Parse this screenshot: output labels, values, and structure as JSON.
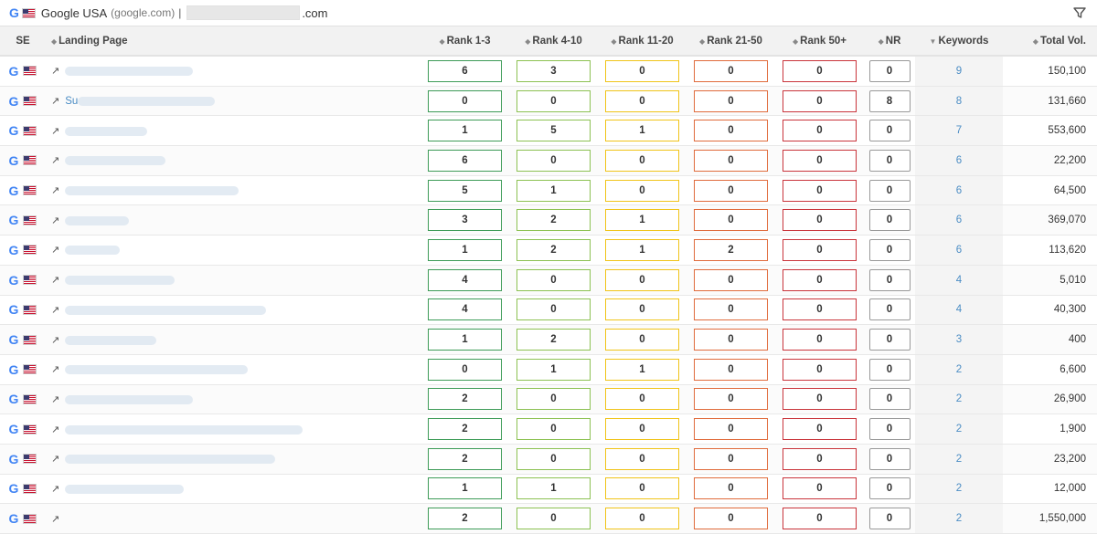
{
  "topbar": {
    "se_name": "Google USA",
    "se_domain": "(google.com)",
    "separator": "|",
    "domain_suffix": ".com"
  },
  "colors": {
    "rank_1_3": "#3d9b57",
    "rank_4_10": "#8cc152",
    "rank_11_20": "#f0c419",
    "rank_21_50": "#e06b3c",
    "rank_50_plus": "#c9343b",
    "nr": "#999999",
    "link": "#4a8cc4"
  },
  "header": {
    "se": "SE",
    "landing_page": "Landing Page",
    "rank_1_3": "Rank 1-3",
    "rank_4_10": "Rank 4-10",
    "rank_11_20": "Rank 11-20",
    "rank_21_50": "Rank 21-50",
    "rank_50_plus": "Rank 50+",
    "nr": "NR",
    "keywords": "Keywords",
    "total_vol": "Total Vol."
  },
  "rows": [
    {
      "lp": "",
      "r1": "6",
      "r2": "3",
      "r3": "0",
      "r4": "0",
      "r5": "0",
      "nr": "0",
      "kw": "9",
      "vol": "150,100"
    },
    {
      "lp": "Su",
      "r1": "0",
      "r2": "0",
      "r3": "0",
      "r4": "0",
      "r5": "0",
      "nr": "8",
      "kw": "8",
      "vol": "131,660"
    },
    {
      "lp": "",
      "r1": "1",
      "r2": "5",
      "r3": "1",
      "r4": "0",
      "r5": "0",
      "nr": "0",
      "kw": "7",
      "vol": "553,600"
    },
    {
      "lp": "",
      "r1": "6",
      "r2": "0",
      "r3": "0",
      "r4": "0",
      "r5": "0",
      "nr": "0",
      "kw": "6",
      "vol": "22,200"
    },
    {
      "lp": "",
      "r1": "5",
      "r2": "1",
      "r3": "0",
      "r4": "0",
      "r5": "0",
      "nr": "0",
      "kw": "6",
      "vol": "64,500"
    },
    {
      "lp": "",
      "r1": "3",
      "r2": "2",
      "r3": "1",
      "r4": "0",
      "r5": "0",
      "nr": "0",
      "kw": "6",
      "vol": "369,070"
    },
    {
      "lp": "",
      "r1": "1",
      "r2": "2",
      "r3": "1",
      "r4": "2",
      "r5": "0",
      "nr": "0",
      "kw": "6",
      "vol": "113,620"
    },
    {
      "lp": "",
      "r1": "4",
      "r2": "0",
      "r3": "0",
      "r4": "0",
      "r5": "0",
      "nr": "0",
      "kw": "4",
      "vol": "5,010"
    },
    {
      "lp": "",
      "r1": "4",
      "r2": "0",
      "r3": "0",
      "r4": "0",
      "r5": "0",
      "nr": "0",
      "kw": "4",
      "vol": "40,300"
    },
    {
      "lp": "",
      "r1": "1",
      "r2": "2",
      "r3": "0",
      "r4": "0",
      "r5": "0",
      "nr": "0",
      "kw": "3",
      "vol": "400"
    },
    {
      "lp": "",
      "r1": "0",
      "r2": "1",
      "r3": "1",
      "r4": "0",
      "r5": "0",
      "nr": "0",
      "kw": "2",
      "vol": "6,600"
    },
    {
      "lp": "",
      "r1": "2",
      "r2": "0",
      "r3": "0",
      "r4": "0",
      "r5": "0",
      "nr": "0",
      "kw": "2",
      "vol": "26,900"
    },
    {
      "lp": "",
      "r1": "2",
      "r2": "0",
      "r3": "0",
      "r4": "0",
      "r5": "0",
      "nr": "0",
      "kw": "2",
      "vol": "1,900"
    },
    {
      "lp": "",
      "r1": "2",
      "r2": "0",
      "r3": "0",
      "r4": "0",
      "r5": "0",
      "nr": "0",
      "kw": "2",
      "vol": "23,200"
    },
    {
      "lp": "",
      "r1": "1",
      "r2": "1",
      "r3": "0",
      "r4": "0",
      "r5": "0",
      "nr": "0",
      "kw": "2",
      "vol": "12,000"
    },
    {
      "lp": "",
      "r1": "2",
      "r2": "0",
      "r3": "0",
      "r4": "0",
      "r5": "0",
      "nr": "0",
      "kw": "2",
      "vol": "1,550,000"
    }
  ]
}
